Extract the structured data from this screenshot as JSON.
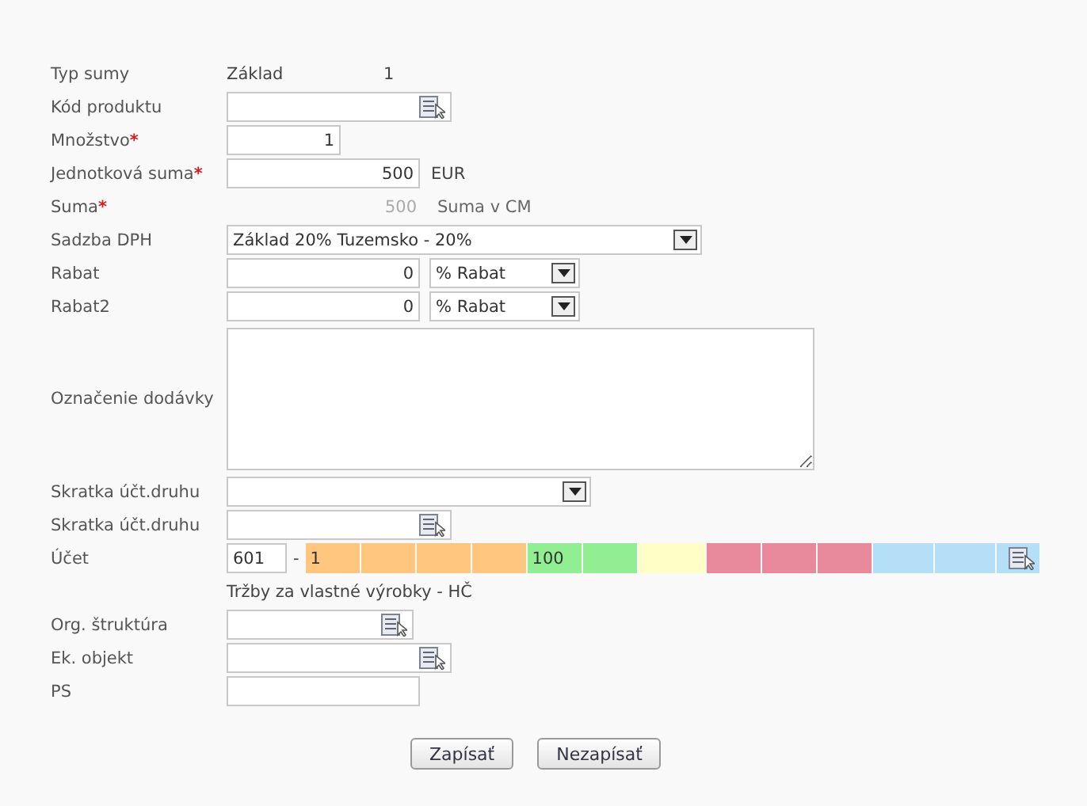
{
  "rows": [
    {
      "kind": "static",
      "label": "Typ sumy",
      "value": "Základ",
      "value2": "1"
    },
    {
      "kind": "lookup",
      "label": "Kód produktu"
    },
    {
      "kind": "number",
      "label": "Množstvo",
      "marker": "*",
      "value": "1"
    },
    {
      "kind": "number",
      "label": "Jednotková suma",
      "marker": "*",
      "value": "500",
      "suffix": "EUR"
    },
    {
      "kind": "readonly",
      "label": "Suma",
      "marker": "*",
      "value": "500",
      "suffix": "Suma v CM"
    },
    {
      "kind": "select",
      "label": "Sadzba DPH",
      "value": "Základ 20% Tuzemsko - 20%"
    },
    {
      "kind": "number_select",
      "label": "Rabat",
      "value": "0",
      "option": "% Rabat"
    },
    {
      "kind": "number_select",
      "label": "Rabat2",
      "value": "0",
      "option": "% Rabat"
    },
    {
      "kind": "textarea",
      "label": "Označenie dodávky"
    },
    {
      "kind": "select",
      "label": "Skratka účt.druhu"
    },
    {
      "kind": "lookup",
      "label": "Skratka účt.druhu"
    },
    {
      "kind": "account",
      "label": "Účet",
      "value": "601",
      "separator": "-",
      "segments": [
        {
          "value": "1",
          "color": "#ffc67f"
        },
        {
          "color": "#ffc67f"
        },
        {
          "color": "#ffc67f"
        },
        {
          "color": "#ffc67f"
        },
        {
          "value": "100",
          "color": "#92ee92"
        },
        {
          "color": "#92ee92"
        },
        {
          "color": "#fefec6"
        },
        {
          "color": "#e98a9c"
        },
        {
          "color": "#e98a9c"
        },
        {
          "color": "#e98a9c"
        },
        {
          "color": "#b5dff7"
        },
        {
          "color": "#b5dff7"
        },
        {
          "color": "#b5dff7"
        }
      ]
    },
    {
      "kind": "note",
      "value": "Tržby za vlastné výrobky - HČ"
    },
    {
      "kind": "lookup",
      "label": "Org. štruktúra"
    },
    {
      "kind": "lookup",
      "label": "Ek. objekt"
    },
    {
      "kind": "text",
      "label": "PS"
    }
  ],
  "buttons": [
    "Zapísať",
    "Nezapísať"
  ]
}
